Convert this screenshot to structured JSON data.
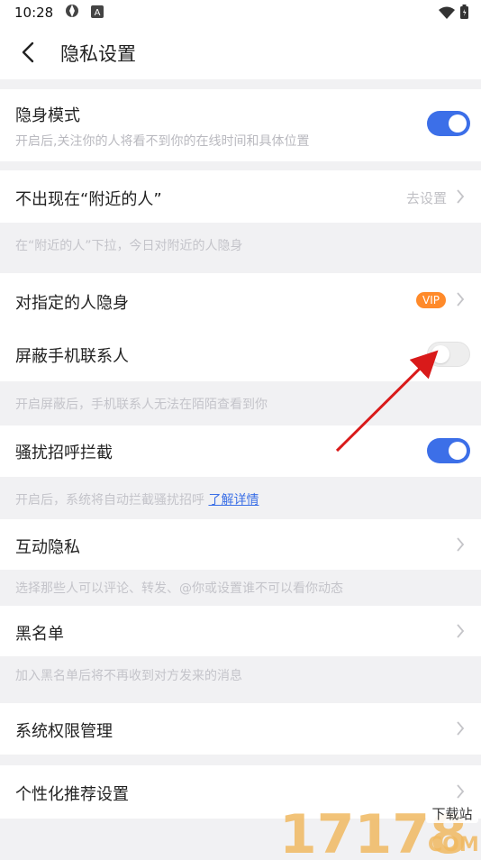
{
  "status_bar": {
    "time": "10:28",
    "icons": [
      "sync-icon",
      "a-badge-icon",
      "wifi-icon",
      "battery-icon"
    ]
  },
  "header": {
    "title": "隐私设置",
    "back_icon": "chevron-left-icon"
  },
  "settings": [
    {
      "title": "隐身模式",
      "subtitle": "开启后,关注你的人将看不到你的在线时间和具体位置",
      "toggle": true
    },
    {
      "title": "不出现在“附近的人”",
      "right_text": "去设置",
      "hint": "在“附近的人”下拉，今日对附近的人隐身"
    },
    {
      "title": "对指定的人隐身",
      "badge": "VIP"
    },
    {
      "title": "屏蔽手机联系人",
      "toggle": false,
      "hint": "开启屏蔽后，手机联系人无法在陌陌查看到你"
    },
    {
      "title": "骚扰招呼拦截",
      "toggle": true,
      "hint": "开启后，系统将自动拦截骚扰招呼",
      "hint_link": "了解详情"
    },
    {
      "title": "互动隐私",
      "hint": "选择那些人可以评论、转发、@你或设置谁不可以看你动态"
    },
    {
      "title": "黑名单",
      "hint": "加入黑名单后将不再收到对方发来的消息"
    },
    {
      "title": "系统权限管理"
    },
    {
      "title": "个性化推荐设置"
    }
  ],
  "colors": {
    "accent": "#3c6fe8",
    "vip": "#ff8a2a",
    "annotation_arrow": "#d91a1a",
    "page_bg": "#f1f1f3"
  },
  "watermark": {
    "text": "17178",
    "badge": "下载站",
    "domain": "COM"
  }
}
